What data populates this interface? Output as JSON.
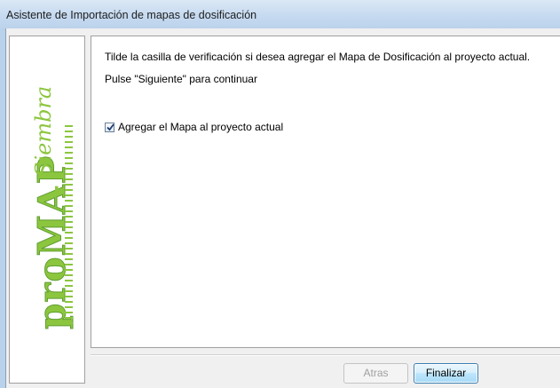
{
  "window": {
    "title": "Asistente de Importación de mapas de dosificación"
  },
  "sidebar": {
    "logo_text": "proMAP",
    "logo_sub": "Siembra",
    "colors": {
      "green": "#8cc63f",
      "green_dark": "#5f9e2f"
    }
  },
  "main": {
    "instruction": "Tilde la casilla de verificación si desea agregar el Mapa de Dosificación al proyecto actual.",
    "continue_text": "Pulse \"Siguiente\" para continuar",
    "checkbox": {
      "label": "Agregar el Mapa al proyecto actual",
      "checked": true
    }
  },
  "footer": {
    "back_label": "Atras",
    "finish_label": "Finalizar"
  }
}
